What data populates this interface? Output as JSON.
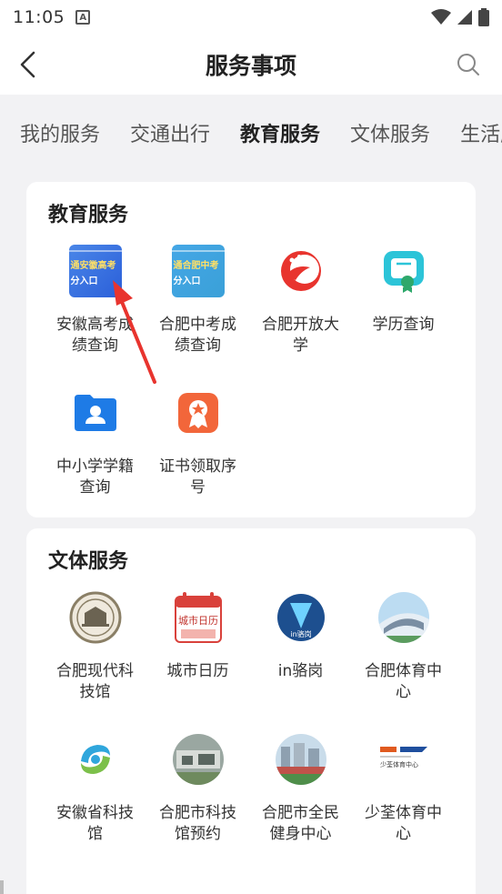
{
  "status": {
    "time": "11:05",
    "a_badge": "A"
  },
  "header": {
    "title": "服务事项"
  },
  "tabs": [
    {
      "label": "我的服务"
    },
    {
      "label": "交通出行"
    },
    {
      "label": "教育服务"
    },
    {
      "label": "文体服务"
    },
    {
      "label": "生活服务"
    }
  ],
  "sections": {
    "education": {
      "title": "教育服务",
      "items": [
        {
          "label": "安徽高考成绩查询",
          "banner_line1": "通安徽高考",
          "banner_line2": "分入口"
        },
        {
          "label": "合肥中考成绩查询",
          "banner_line1": "通合肥中考",
          "banner_line2": "分入口"
        },
        {
          "label": "合肥开放大学"
        },
        {
          "label": "学历查询"
        },
        {
          "label": "中小学学籍查询"
        },
        {
          "label": "证书领取序号"
        }
      ]
    },
    "culture": {
      "title": "文体服务",
      "items": [
        {
          "label": "合肥现代科技馆"
        },
        {
          "label": "城市日历",
          "icon_text": "城市日历"
        },
        {
          "label": "in骆岗",
          "icon_text": "in骆岗"
        },
        {
          "label": "合肥体育中心"
        },
        {
          "label": "安徽省科技馆"
        },
        {
          "label": "合肥市科技馆预约"
        },
        {
          "label": "合肥市全民健身中心"
        },
        {
          "label": "少荃体育中心",
          "icon_text": "少荃体育中心"
        }
      ]
    }
  },
  "colors": {
    "accent_red": "#e8342e",
    "blue": "#1e7be6",
    "teal": "#2cc4d8",
    "orange": "#f2663a"
  }
}
